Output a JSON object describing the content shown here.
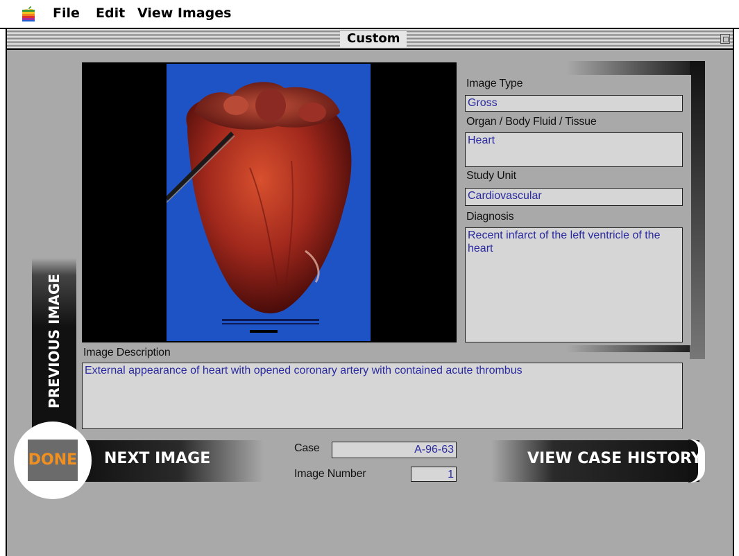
{
  "menubar": {
    "items": [
      "File",
      "Edit",
      "View Images"
    ]
  },
  "window": {
    "title": "Custom"
  },
  "image": {
    "icon": "heart-specimen-photo"
  },
  "panel": {
    "image_type_label": "Image Type",
    "image_type_value": "Gross",
    "organ_label": "Organ / Body Fluid / Tissue",
    "organ_value": "Heart",
    "study_unit_label": "Study Unit",
    "study_unit_value": "Cardiovascular",
    "diagnosis_label": "Diagnosis",
    "diagnosis_value": "Recent infarct of the left ventricle of the heart"
  },
  "description": {
    "label": "Image Description",
    "value": "External appearance of heart with opened coronary artery with contained acute thrombus"
  },
  "buttons": {
    "previous": "PREVIOUS IMAGE",
    "next": "NEXT IMAGE",
    "done": "DONE",
    "history": "VIEW CASE HISTORY"
  },
  "footer": {
    "case_label": "Case",
    "case_value": "A-96-63",
    "image_number_label": "Image Number",
    "image_number_value": "1"
  },
  "colors": {
    "window_bg": "#a9a9a9",
    "field_bg": "#d6d6d6",
    "field_text": "#2a2aa0",
    "done_text": "#f09020",
    "photo_bg": "#1e53c6"
  }
}
